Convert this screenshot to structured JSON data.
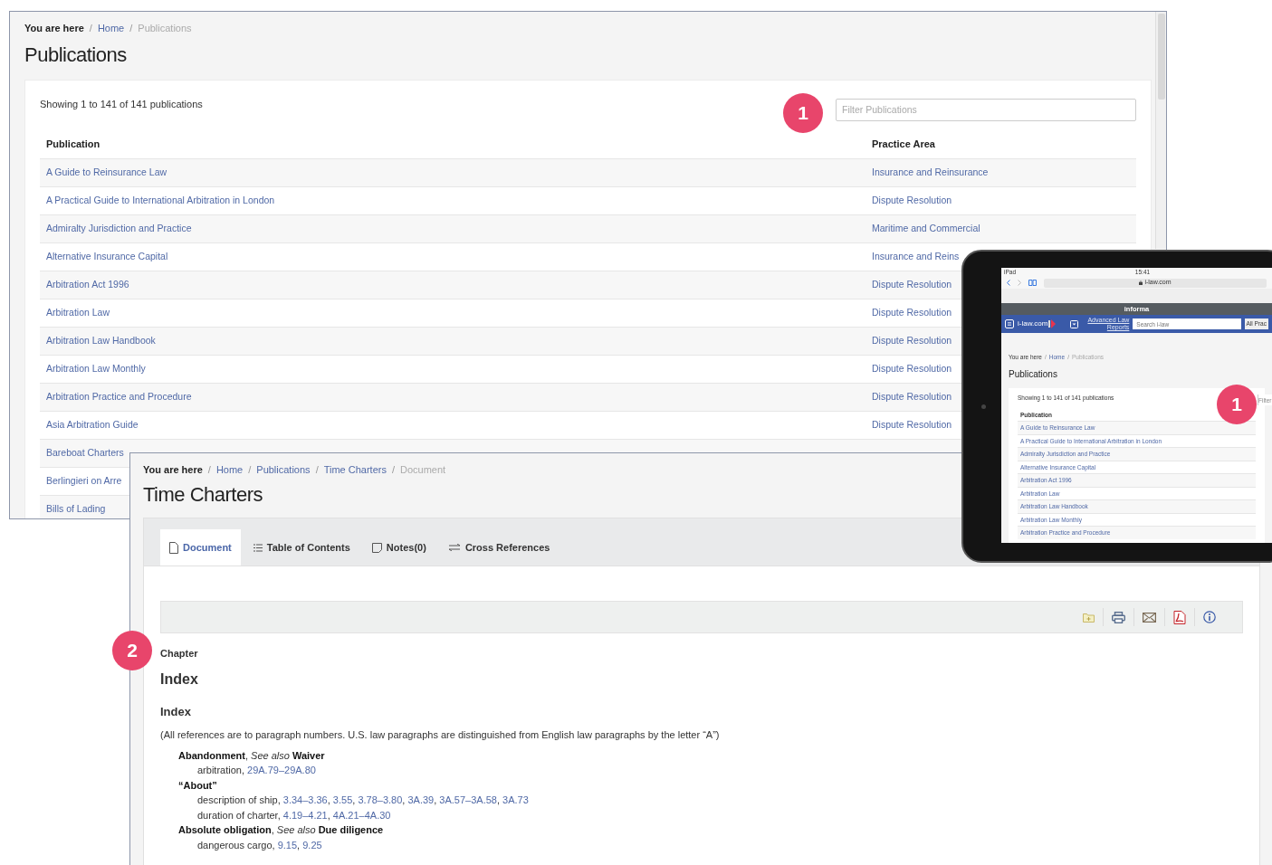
{
  "publications_window": {
    "breadcrumb": {
      "label": "You are here",
      "separator": "/",
      "items": [
        {
          "text": "Home",
          "link": true
        },
        {
          "text": "Publications",
          "link": false
        }
      ]
    },
    "title": "Publications",
    "count_text": "Showing 1 to 141 of 141 publications",
    "filter": {
      "placeholder": "Filter Publications"
    },
    "columns": [
      "Publication",
      "Practice Area"
    ],
    "rows": [
      {
        "publication": "A Guide to Reinsurance Law",
        "practice_area": "Insurance and Reinsurance"
      },
      {
        "publication": "A Practical Guide to International Arbitration in London",
        "practice_area": "Dispute Resolution"
      },
      {
        "publication": "Admiralty Jurisdiction and Practice",
        "practice_area": "Maritime and Commercial"
      },
      {
        "publication": "Alternative Insurance Capital",
        "practice_area": "Insurance and Reins"
      },
      {
        "publication": "Arbitration Act 1996",
        "practice_area": "Dispute Resolution"
      },
      {
        "publication": "Arbitration Law",
        "practice_area": "Dispute Resolution"
      },
      {
        "publication": "Arbitration Law Handbook",
        "practice_area": "Dispute Resolution"
      },
      {
        "publication": "Arbitration Law Monthly",
        "practice_area": "Dispute Resolution"
      },
      {
        "publication": "Arbitration Practice and Procedure",
        "practice_area": "Dispute Resolution"
      },
      {
        "publication": "Asia Arbitration Guide",
        "practice_area": "Dispute Resolution"
      },
      {
        "publication": "Bareboat Charters"
      },
      {
        "publication": "Berlingieri on Arre"
      },
      {
        "publication": "Bills of Lading"
      }
    ]
  },
  "document_window": {
    "breadcrumb": {
      "label": "You are here",
      "separator": "/",
      "items": [
        {
          "text": "Home",
          "link": true
        },
        {
          "text": "Publications",
          "link": true
        },
        {
          "text": "Time Charters",
          "link": true
        },
        {
          "text": "Document",
          "link": false
        }
      ]
    },
    "title": "Time Charters",
    "tabs": [
      {
        "label": "Document",
        "kind": "document",
        "selected": true
      },
      {
        "label": "Table of Contents",
        "kind": "contents",
        "selected": false
      },
      {
        "label": "Notes(0)",
        "kind": "notes",
        "selected": false
      },
      {
        "label": "Cross References",
        "kind": "references",
        "selected": false
      }
    ],
    "chapter_label": "Chapter",
    "chapter_title": "Index",
    "section_title": "Index",
    "note": "(All references are to paragraph numbers. U.S. law paragraphs are distinguished from English law paragraphs by the letter “A”)",
    "entries": [
      {
        "term": "Abandonment",
        "extra": ", *See also* **Waiver**",
        "children": [
          {
            "label": "arbitration,",
            "refs": [
              {
                "text": "29A.79–29A.80"
              }
            ]
          }
        ]
      },
      {
        "term": "“About”",
        "children": [
          {
            "label": "description of ship,",
            "refs": [
              {
                "text": "3.34–3.36",
                "sep": ","
              },
              {
                "text": "3.55",
                "sep": ","
              },
              {
                "text": "3.78–3.80",
                "sep": ","
              },
              {
                "text": "3A.39",
                "sep": ","
              },
              {
                "text": "3A.57–3A.58",
                "sep": ","
              },
              {
                "text": "3A.73"
              }
            ]
          },
          {
            "label": "duration of charter,",
            "refs": [
              {
                "text": "4.19–4.21",
                "sep": ","
              },
              {
                "text": "4A.21–4A.30"
              }
            ]
          }
        ]
      },
      {
        "term": "Absolute obligation",
        "extra": ", *See also* **Due diligence**",
        "children": [
          {
            "label": "dangerous cargo,",
            "refs": [
              {
                "text": "9.15",
                "sep": ","
              },
              {
                "text": "9.25"
              }
            ]
          }
        ]
      }
    ]
  },
  "tablet": {
    "status": {
      "device": "iPad",
      "time": "15:41"
    },
    "address": "i-law.com",
    "brand_bar": "informa",
    "logo": "i-law.com",
    "advanced_link": "Advanced Law Reports",
    "search": {
      "placeholder": "Search i-law"
    },
    "scope": "All Prac",
    "breadcrumb": {
      "label": "You are here",
      "separator": "/",
      "items": [
        {
          "text": "Home",
          "link": true
        },
        {
          "text": "Publications",
          "link": false
        }
      ]
    },
    "title": "Publications",
    "count_text": "Showing 1 to 141 of 141 publications",
    "filter": {
      "placeholder": "Filter"
    },
    "column": "Publication",
    "rows": [
      "A Guide to Reinsurance Law",
      "A Practical Guide to International Arbitration in London",
      "Admiralty Jurisdiction and Practice",
      "Alternative Insurance Capital",
      "Arbitration Act 1996",
      "Arbitration Law",
      "Arbitration Law Handbook",
      "Arbitration Law Monthly",
      "Arbitration Practice and Procedure"
    ]
  },
  "callouts": [
    {
      "number": "1"
    },
    {
      "number": "1"
    },
    {
      "number": "2"
    }
  ]
}
